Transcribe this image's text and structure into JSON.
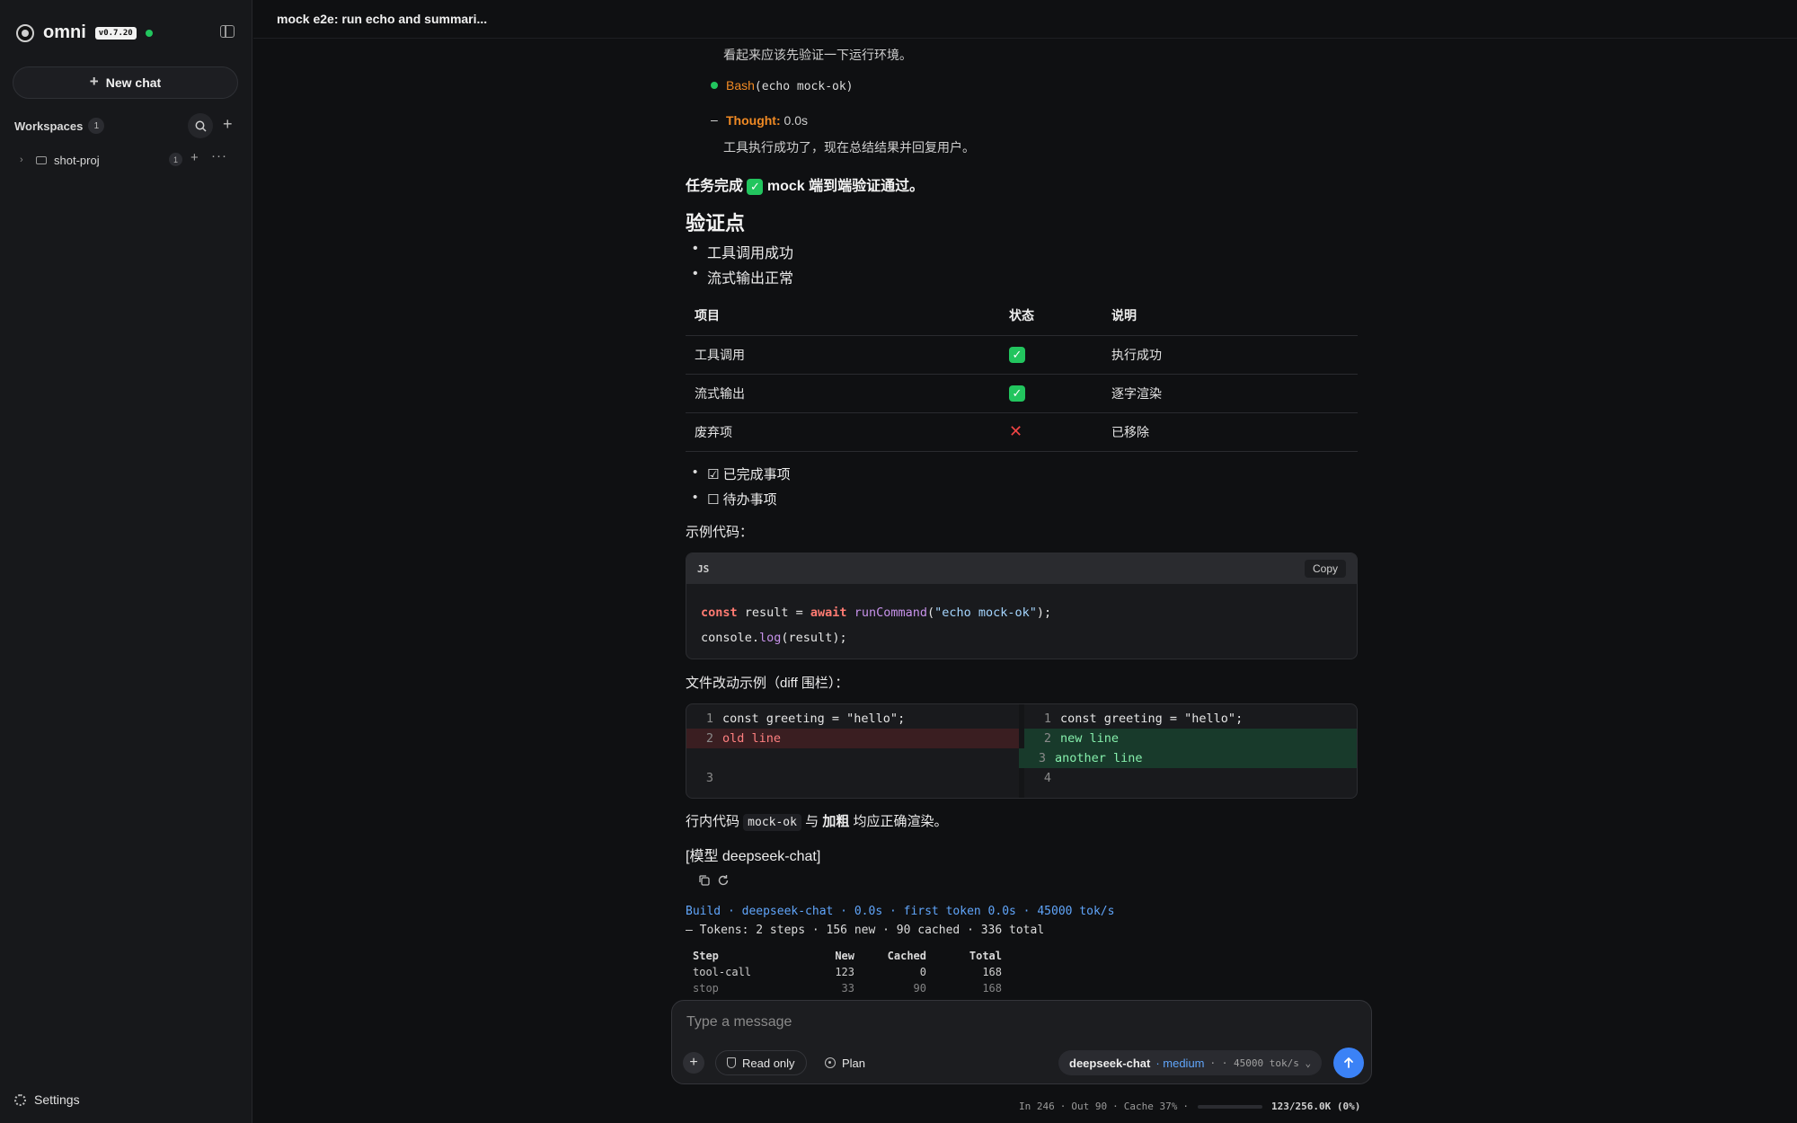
{
  "sidebar": {
    "brand": "omni",
    "version": "v0.7.20",
    "new_chat": "New chat",
    "workspaces_title": "Workspaces",
    "workspaces_count": "1",
    "project": {
      "name": "shot-proj",
      "count": "1"
    },
    "settings": "Settings"
  },
  "header": {
    "title": "mock e2e: run echo and summari..."
  },
  "messages": {
    "thought_text_top": "看起来应该先验证一下运行环境。",
    "bash_label": "Bash",
    "bash_cmd": "(echo mock-ok)",
    "thought_label": "Thought:",
    "thought_time": "0.0s",
    "thought_text": "工具执行成功了，现在总结结果并回复用户。",
    "complete_prefix": "任务完成 ",
    "complete_check": "✓",
    "complete_suffix": " mock 端到端验证通过。",
    "heading": "验证点",
    "bullets": [
      "工具调用成功",
      "流式输出正常"
    ],
    "table": {
      "headers": [
        "项目",
        "状态",
        "说明"
      ],
      "rows": [
        {
          "item": "工具调用",
          "status": "✓",
          "note": "执行成功"
        },
        {
          "item": "流式输出",
          "status": "✓",
          "note": "逐字渲染"
        },
        {
          "item": "废弃项",
          "status": "✕",
          "note": "已移除"
        }
      ]
    },
    "tasks": [
      {
        "checkbox": "☑",
        "text": "已完成事项"
      },
      {
        "checkbox": "☐",
        "text": "待办事项"
      }
    ],
    "example_label": "示例代码：",
    "code": {
      "lang": "JS",
      "copy": "Copy",
      "line1": {
        "kw1": "const",
        "var": " result = ",
        "kw2": "await",
        "fn": " runCommand",
        "open": "(",
        "str": "\"echo mock-ok\"",
        "close": ");"
      },
      "line2": {
        "obj": "console.",
        "fn": "log",
        "rest": "(result);"
      }
    },
    "diff_label": "文件改动示例（diff 围栏）：",
    "diff": {
      "left": [
        {
          "n": "1",
          "text": "const greeting = \"hello\";"
        },
        {
          "n": "2",
          "text": "old line"
        },
        {
          "n": "3",
          "text": ""
        }
      ],
      "right": [
        {
          "n": "1",
          "text": "const greeting = \"hello\";"
        },
        {
          "n": "2",
          "text": "new line"
        },
        {
          "n": "3",
          "text": "another line"
        },
        {
          "n": "4",
          "text": ""
        }
      ]
    },
    "inline_prefix": "行内代码 ",
    "inline_code": "mock-ok",
    "inline_mid": " 与 ",
    "inline_bold": "加粗",
    "inline_suffix": " 均应正确渲染。",
    "model_tag": "[模型 deepseek-chat]",
    "stats_line": "Build · deepseek-chat · 0.0s · first token 0.0s · 45000 tok/s",
    "tokens_line": "— Tokens: 2 steps · 156 new · 90 cached · 336 total",
    "token_table": {
      "headers": [
        "Step",
        "New",
        "Cached",
        "Total"
      ],
      "rows": [
        [
          "tool-call",
          "123",
          "0",
          "168"
        ],
        [
          "stop",
          "33",
          "90",
          "168"
        ]
      ]
    }
  },
  "composer": {
    "placeholder": "Type a message",
    "read_only": "Read only",
    "plan": "Plan",
    "model": "deepseek-chat",
    "effort": "· medium",
    "speed": "· · 45000 tok/s ⌄"
  },
  "status": {
    "in": "In 246",
    "out": "Out 90",
    "cache": "Cache 37%",
    "sep": "·",
    "ctx": "123/256.0K (0%)",
    "context_fraction": 0
  },
  "colors": {
    "accent": "#3b82f6",
    "success": "#22c55e",
    "danger": "#ef4444",
    "thought": "#f08a24"
  }
}
